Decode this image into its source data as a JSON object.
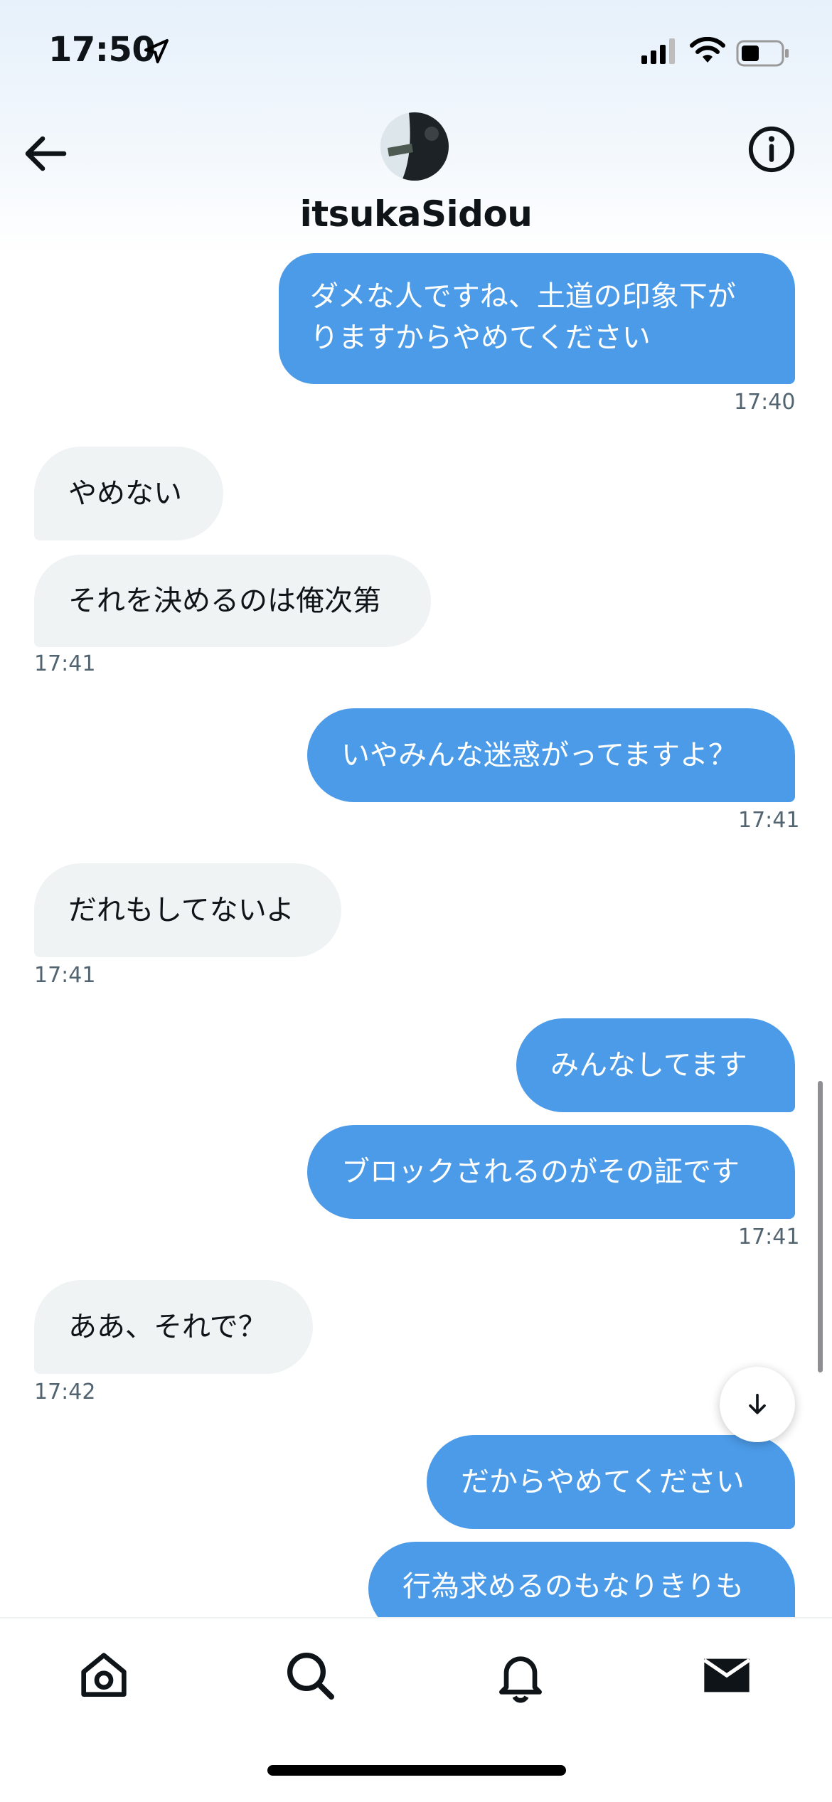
{
  "status_bar": {
    "time": "17:50"
  },
  "header": {
    "name": "itsukaSidou"
  },
  "messages": [
    {
      "text": "ダメな人ですね、土道の印象下がりますからやめてください",
      "side": "sent"
    },
    {
      "time": "17:40"
    },
    {
      "text": "やめない",
      "side": "received"
    },
    {
      "text": "それを決めるのは俺次第",
      "side": "received"
    },
    {
      "time": "17:41"
    },
    {
      "text": "いやみんな迷惑がってますよ？",
      "side": "sent"
    },
    {
      "time": "17:41"
    },
    {
      "text": "だれもしてないよ",
      "side": "received"
    },
    {
      "time": "17:41"
    },
    {
      "text": "みんなしてます",
      "side": "sent"
    },
    {
      "text": "ブロックされるのがその証です",
      "side": "sent"
    },
    {
      "time": "17:41"
    },
    {
      "text": "ああ、それで？",
      "side": "received"
    },
    {
      "time": "17:42"
    },
    {
      "text": "だからやめてください",
      "side": "sent"
    },
    {
      "text": "行為求めるのもなりきりも",
      "side": "sent"
    }
  ],
  "msg_lines": [
    "ダメな人ですね、土道の印象下が",
    "りますからやめてください"
  ],
  "tabs": [
    "home-icon",
    "search-icon",
    "notifications-icon",
    "messages-icon"
  ],
  "colors": {
    "sent_bubble": "#4c9be8",
    "received_bubble": "#eff3f4",
    "timestamp": "#536471"
  }
}
